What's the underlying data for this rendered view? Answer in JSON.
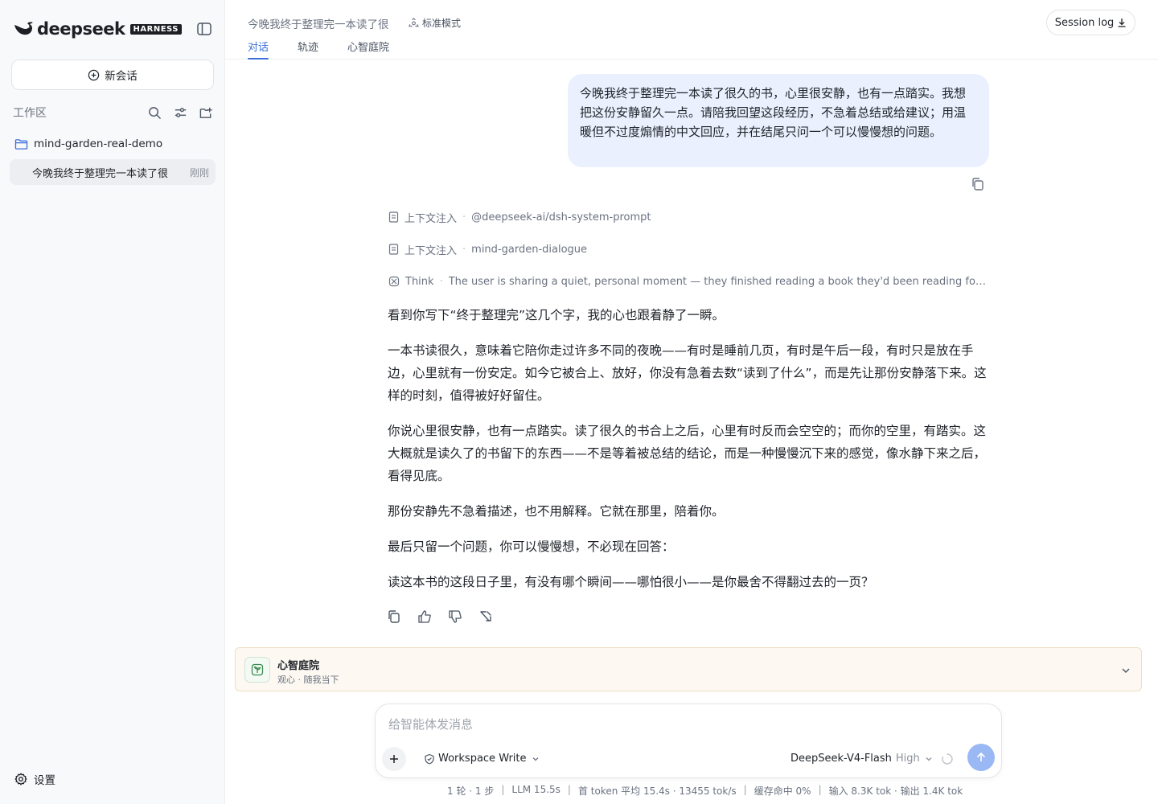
{
  "brand": {
    "name": "deepseek",
    "badge": "HARNESS"
  },
  "sidebar": {
    "new_chat_label": "新会话",
    "workspace_title": "工作区",
    "folder_name": "mind-garden-real-demo",
    "sessions": [
      {
        "title": "今晚我终于整理完一本读了很",
        "time": "刚刚"
      }
    ],
    "settings_label": "设置"
  },
  "header": {
    "conversation_title": "今晚我终于整理完一本读了很",
    "mode_label": "标准模式",
    "tabs": [
      {
        "label": "对话",
        "active": true
      },
      {
        "label": "轨迹",
        "active": false
      },
      {
        "label": "心智庭院",
        "active": false
      }
    ],
    "session_log_label": "Session log"
  },
  "chat": {
    "user_message": "今晚我终于整理完一本读了很久的书，心里很安静，也有一点踏实。我想把这份安静留久一点。请陪我回望这段经历，不急着总结或给建议；用温暖但不过度煽情的中文回应，并在结尾只问一个可以慢慢想的问题。",
    "context_injections": [
      {
        "label": "上下文注入",
        "detail": "@deepseek-ai/dsh-system-prompt"
      },
      {
        "label": "上下文注入",
        "detail": "mind-garden-dialogue"
      }
    ],
    "think": {
      "label": "Think",
      "text": "The user is sharing a quiet, personal moment — they finished reading a book they'd been reading for a lon..."
    },
    "answer_paragraphs": [
      "看到你写下“终于整理完”这几个字，我的心也跟着静了一瞬。",
      "一本书读很久，意味着它陪你走过许多不同的夜晚——有时是睡前几页，有时是午后一段，有时只是放在手边，心里就有一份安定。如今它被合上、放好，你没有急着去数“读到了什么”，而是先让那份安静落下来。这样的时刻，值得被好好留住。",
      "你说心里很安静，也有一点踏实。读了很久的书合上之后，心里有时反而会空空的；而你的空里，有踏实。这大概就是读久了的书留下的东西——不是等着被总结的结论，而是一种慢慢沉下来的感觉，像水静下来之后，看得见底。",
      "那份安静先不急着描述，也不用解释。它就在那里，陪着你。",
      "最后只留一个问题，你可以慢慢想，不必现在回答：",
      "读这本书的这段日子里，有没有哪个瞬间——哪怕很小——是你最舍不得翻过去的一页？"
    ]
  },
  "garden": {
    "title": "心智庭院",
    "subtitle": "观心 · 随我当下"
  },
  "composer": {
    "placeholder": "给智能体发消息",
    "value": "",
    "permission_label": "Workspace Write",
    "model_label": "DeepSeek-V4-Flash",
    "effort_label": "High"
  },
  "status": {
    "items": [
      "1 轮 · 1 步",
      "LLM 15.5s",
      "首 token 平均 15.4s · 13455 tok/s",
      "缓存命中 0%",
      "输入 8.3K tok · 输出 1.4K tok"
    ]
  },
  "colors": {
    "accent": "#3b6fd9",
    "user_bubble": "#eaf0fd",
    "send_button": "#9ab8f4",
    "garden_bg": "#fdf9f2",
    "folder_icon": "#3b6fd9"
  }
}
